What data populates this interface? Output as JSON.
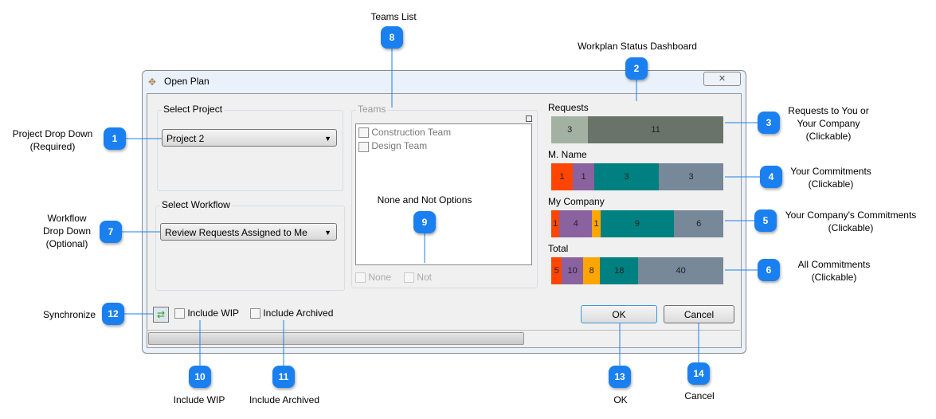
{
  "dialog": {
    "title": "Open Plan",
    "close": "✕",
    "project_group": "Select Project",
    "project_value": "Project 2",
    "workflow_group": "Select Workflow",
    "workflow_value": "Review Requests Assigned to Me",
    "teams_group": "Teams",
    "teams": [
      "Construction Team",
      "Design Team"
    ],
    "none_label": "None",
    "not_label": "Not",
    "include_wip": "Include WIP",
    "include_archived": "Include Archived",
    "ok": "OK",
    "cancel": "Cancel"
  },
  "dashboard": {
    "colors": {
      "orangered": "#FF4500",
      "purple": "#8B62A0",
      "orange": "#FFA500",
      "teal": "#008080",
      "slate": "#778899",
      "req_light": "#A3B1A3",
      "req_dark": "#6A736A"
    },
    "bars": [
      {
        "label": "Requests",
        "segments": [
          {
            "v": 3,
            "c": "#A3B1A3"
          },
          {
            "v": 11,
            "c": "#6A736A"
          }
        ]
      },
      {
        "label": "M. Name",
        "segments": [
          {
            "v": 1,
            "c": "#FF4500"
          },
          {
            "v": 1,
            "c": "#8B62A0"
          },
          {
            "v": 3,
            "c": "#008080"
          },
          {
            "v": 3,
            "c": "#778899"
          }
        ]
      },
      {
        "label": "My Company",
        "segments": [
          {
            "v": 1,
            "c": "#FF4500"
          },
          {
            "v": 4,
            "c": "#8B62A0"
          },
          {
            "v": 1,
            "c": "#FFA500"
          },
          {
            "v": 9,
            "c": "#008080"
          },
          {
            "v": 6,
            "c": "#778899"
          }
        ]
      },
      {
        "label": "Total",
        "segments": [
          {
            "v": 5,
            "c": "#FF4500"
          },
          {
            "v": 10,
            "c": "#8B62A0"
          },
          {
            "v": 8,
            "c": "#FFA500"
          },
          {
            "v": 18,
            "c": "#008080"
          },
          {
            "v": 40,
            "c": "#778899"
          }
        ]
      }
    ]
  },
  "callouts": [
    {
      "n": "1",
      "text": "Project Drop Down\n(Required)"
    },
    {
      "n": "2",
      "text": "Workplan Status Dashboard"
    },
    {
      "n": "3",
      "text": "Requests to You or\nYour Company\n(Clickable)"
    },
    {
      "n": "4",
      "text": "Your Commitments\n(Clickable)"
    },
    {
      "n": "5",
      "text": "Your Company's Commitments\n(Clickable)"
    },
    {
      "n": "6",
      "text": "All Commitments\n(Clickable)"
    },
    {
      "n": "7",
      "text": "Workflow\nDrop Down\n(Optional)"
    },
    {
      "n": "8",
      "text": "Teams List"
    },
    {
      "n": "9",
      "text": "None and Not Options"
    },
    {
      "n": "10",
      "text": "Include WIP"
    },
    {
      "n": "11",
      "text": "Include Archived"
    },
    {
      "n": "12",
      "text": "Synchronize"
    },
    {
      "n": "13",
      "text": "OK"
    },
    {
      "n": "14",
      "text": "Cancel"
    }
  ]
}
